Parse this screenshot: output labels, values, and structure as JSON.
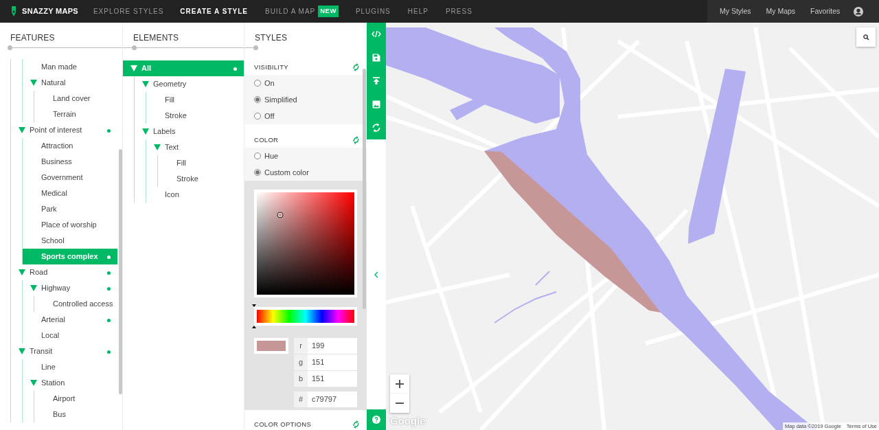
{
  "navbar": {
    "logo": "SNAZZY MAPS",
    "links": [
      {
        "label": "EXPLORE STYLES",
        "selected": false
      },
      {
        "label": "CREATE A STYLE",
        "selected": true
      },
      {
        "label": "BUILD A MAP",
        "selected": false,
        "badge": "NEW"
      },
      {
        "label": "PLUGINS",
        "selected": false
      },
      {
        "label": "HELP",
        "selected": false
      },
      {
        "label": "PRESS",
        "selected": false
      }
    ],
    "account_links": [
      "My Styles",
      "My Maps",
      "Favorites"
    ]
  },
  "steps": [
    {
      "title": "FEATURES"
    },
    {
      "title": "ELEMENTS"
    },
    {
      "title": "STYLES"
    }
  ],
  "features": [
    {
      "children": [
        {
          "children": [
            {
              "label": "Man made",
              "selected": false,
              "styled": false
            },
            {
              "label": "Natural",
              "selected": false,
              "styled": false,
              "expanded": true,
              "children": [
                {
                  "label": "Land cover",
                  "selected": false,
                  "styled": false
                },
                {
                  "label": "Terrain",
                  "selected": false,
                  "styled": false
                }
              ]
            }
          ]
        },
        {
          "label": "Point of interest",
          "selected": false,
          "styled": true,
          "expanded": true,
          "children": [
            {
              "label": "Attraction",
              "selected": false,
              "styled": false
            },
            {
              "label": "Business",
              "selected": false,
              "styled": false
            },
            {
              "label": "Government",
              "selected": false,
              "styled": false
            },
            {
              "label": "Medical",
              "selected": false,
              "styled": false
            },
            {
              "label": "Park",
              "selected": false,
              "styled": false
            },
            {
              "label": "Place of worship",
              "selected": false,
              "styled": false
            },
            {
              "label": "School",
              "selected": false,
              "styled": false
            },
            {
              "label": "Sports complex",
              "selected": true,
              "styled": true
            }
          ]
        },
        {
          "label": "Road",
          "selected": false,
          "styled": true,
          "expanded": true,
          "children": [
            {
              "label": "Highway",
              "selected": false,
              "styled": true,
              "expanded": true,
              "children": [
                {
                  "label": "Controlled access",
                  "selected": false,
                  "styled": false
                }
              ]
            },
            {
              "label": "Arterial",
              "selected": false,
              "styled": true
            },
            {
              "label": "Local",
              "selected": false,
              "styled": false
            }
          ]
        },
        {
          "label": "Transit",
          "selected": false,
          "styled": true,
          "expanded": true,
          "children": [
            {
              "label": "Line",
              "selected": false,
              "styled": false
            },
            {
              "label": "Station",
              "selected": false,
              "styled": false,
              "expanded": true,
              "children": [
                {
                  "label": "Airport",
                  "selected": false,
                  "styled": false
                },
                {
                  "label": "Bus",
                  "selected": false,
                  "styled": false
                }
              ]
            }
          ]
        }
      ]
    }
  ],
  "elements": [
    {
      "label": "All",
      "selected": true,
      "styled": true,
      "expanded": true,
      "children": [
        {
          "label": "Geometry",
          "selected": false,
          "styled": false,
          "expanded": true,
          "children": [
            {
              "label": "Fill",
              "selected": false,
              "styled": false
            },
            {
              "label": "Stroke",
              "selected": false,
              "styled": false
            }
          ]
        },
        {
          "label": "Labels",
          "selected": false,
          "styled": false,
          "expanded": true,
          "children": [
            {
              "label": "Text",
              "selected": false,
              "styled": false,
              "expanded": true,
              "children": [
                {
                  "label": "Fill",
                  "selected": false,
                  "styled": false
                },
                {
                  "label": "Stroke",
                  "selected": false,
                  "styled": false
                }
              ]
            },
            {
              "label": "Icon",
              "selected": false,
              "styled": false
            }
          ]
        }
      ]
    }
  ],
  "styles": [
    {
      "title": "VISIBILITY",
      "options": [
        {
          "label": "On",
          "selected": false
        },
        {
          "label": "Simplified",
          "selected": true
        },
        {
          "label": "Off",
          "selected": false
        }
      ]
    },
    {
      "title": "COLOR",
      "options": [
        {
          "label": "Hue",
          "selected": false
        },
        {
          "label": "Custom color",
          "selected": true
        }
      ],
      "picker": {
        "hue": {
          "level": 0
        },
        "channels": [
          {
            "label": "r",
            "value": "199"
          },
          {
            "label": "g",
            "value": "151"
          },
          {
            "label": "b",
            "value": "151"
          }
        ],
        "hex": {
          "label": "#",
          "value": "c79797"
        }
      }
    },
    {
      "title": "COLOR OPTIONS"
    }
  ],
  "map": {
    "logo": "Google",
    "attribution": "Map data ©2019 Google",
    "terms": "Terms of Use"
  }
}
